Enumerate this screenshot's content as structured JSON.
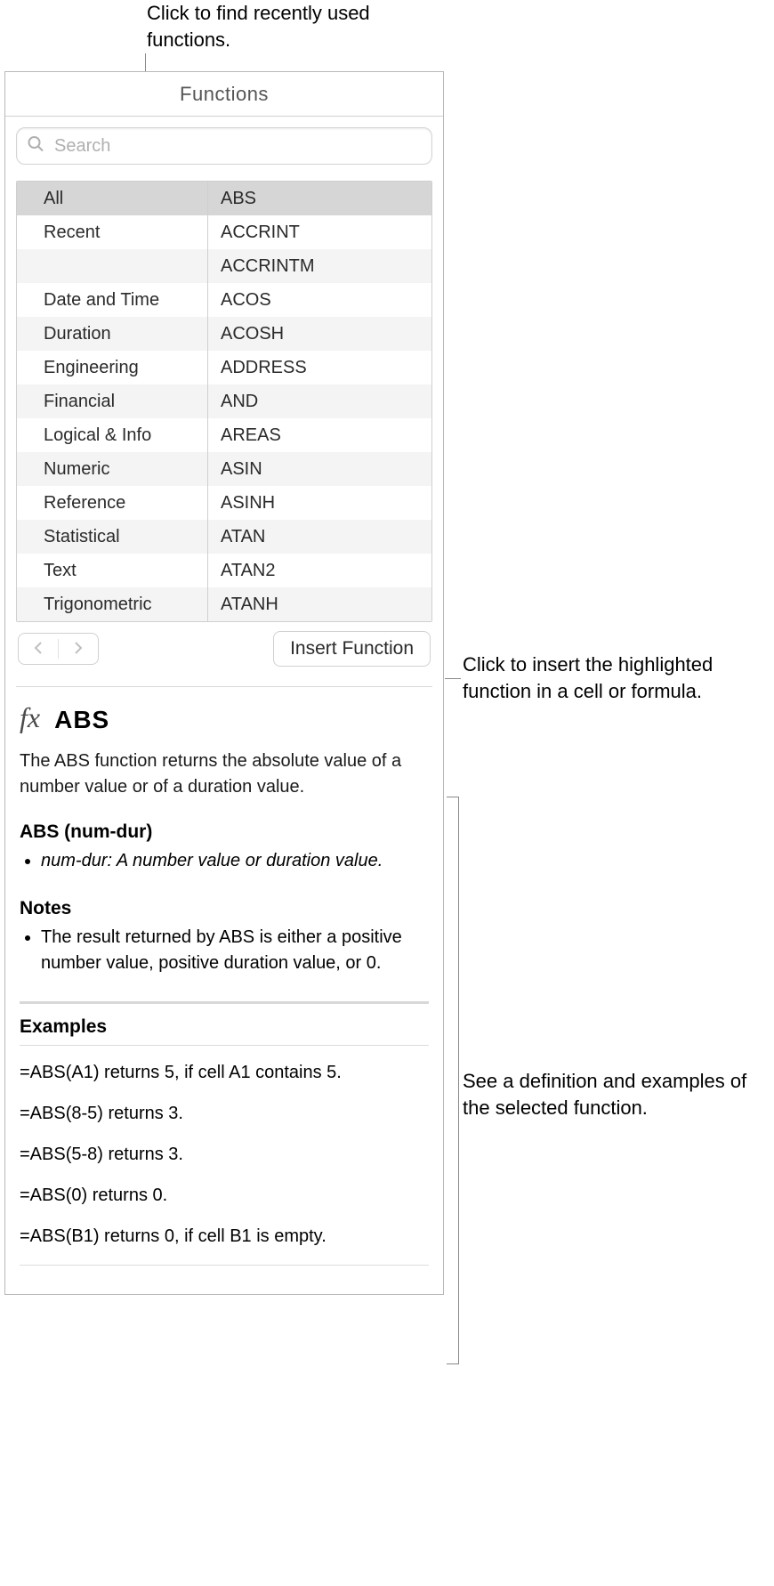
{
  "callouts": {
    "top": "Click to find recently used functions.",
    "insert": "Click to insert the highlighted function in a cell or formula.",
    "detail": "See a definition and examples of the selected function."
  },
  "panel": {
    "title": "Functions",
    "search_placeholder": "Search"
  },
  "categories": [
    "All",
    "Recent",
    "",
    "Date and Time",
    "Duration",
    "Engineering",
    "Financial",
    "Logical & Info",
    "Numeric",
    "Reference",
    "Statistical",
    "Text",
    "Trigonometric"
  ],
  "functions": [
    "ABS",
    "ACCRINT",
    "ACCRINTM",
    "ACOS",
    "ACOSH",
    "ADDRESS",
    "AND",
    "AREAS",
    "ASIN",
    "ASINH",
    "ATAN",
    "ATAN2",
    "ATANH"
  ],
  "selected_category": "All",
  "selected_function": "ABS",
  "buttons": {
    "insert": "Insert Function"
  },
  "detail": {
    "fx_label": "fx",
    "name": "ABS",
    "description": "The ABS function returns the absolute value of a number value or of a duration value.",
    "signature": "ABS (num-dur)",
    "args": [
      "num-dur: A number value or duration value."
    ],
    "notes_label": "Notes",
    "notes": [
      "The result returned by ABS is either a positive number value, positive duration value, or 0."
    ],
    "examples_label": "Examples",
    "examples": [
      "=ABS(A1) returns 5, if cell A1 contains 5.",
      "=ABS(8-5) returns 3.",
      "=ABS(5-8) returns 3.",
      "=ABS(0) returns 0.",
      "=ABS(B1) returns 0, if cell B1 is empty."
    ]
  }
}
